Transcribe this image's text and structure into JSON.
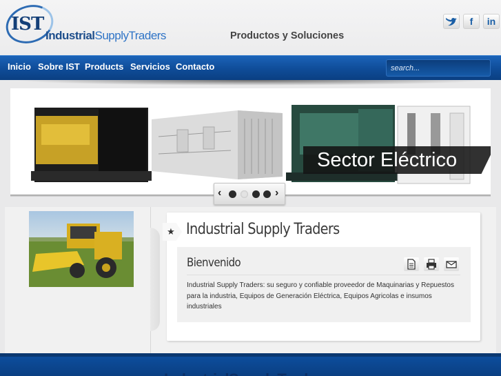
{
  "brand": {
    "logo_mark": "IST",
    "logo_name_part1": "Industrial",
    "logo_name_part2": "SupplyTraders"
  },
  "header": {
    "tagline": "Productos y Soluciones",
    "social": [
      {
        "icon": "twitter-icon",
        "glyph": "🐦"
      },
      {
        "icon": "facebook-icon",
        "glyph": "f"
      },
      {
        "icon": "linkedin-icon",
        "glyph": "in"
      }
    ]
  },
  "nav": {
    "items": [
      "Inicio",
      "Sobre IST",
      "Products",
      "Servicios",
      "Contacto"
    ],
    "search_placeholder": "search..."
  },
  "slider": {
    "caption": "Sector Eléctrico",
    "prev_icon": "‹",
    "next_icon": "›",
    "active_dot": 1,
    "dot_count": 4
  },
  "main": {
    "title": "Industrial Supply Traders",
    "article": {
      "heading": "Bienvenido",
      "body": "Industrial Supply Traders: su seguro y confiable proveedor de Maquinarias y Repuestos para la industria, Equipos de Generación Eléctrica, Equipos Agricolas e insumos industriales"
    },
    "tools": [
      "pdf-icon",
      "print-icon",
      "email-icon"
    ]
  },
  "footer": {
    "text": "IndustrialSupplyTraders"
  },
  "colors": {
    "nav_blue": "#0f4c98",
    "brand_dark": "#143f78",
    "brand_light": "#2f74c6"
  }
}
